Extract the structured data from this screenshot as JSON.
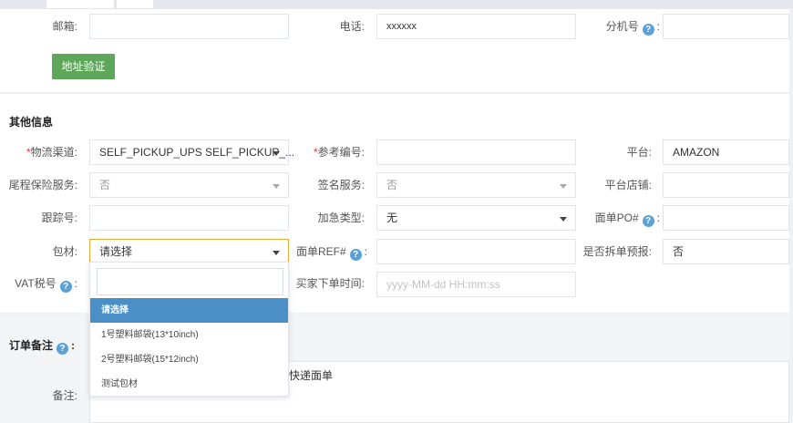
{
  "contact": {
    "email_label": "邮箱:",
    "email_value": "",
    "phone_label": "电话:",
    "phone_value": "xxxxxx",
    "ext_label": "分机号",
    "ext_colon": ":",
    "ext_value": "",
    "verify_button": "地址验证"
  },
  "other_info": {
    "title": "其他信息",
    "channel_label": "物流渠道:",
    "channel_value": "SELF_PICKUP_UPS SELF_PICKUP_...",
    "ref_label": "参考编号:",
    "ref_value": "",
    "platform_label": "平台:",
    "platform_value": "AMAZON",
    "insurance_label": "尾程保险服务:",
    "insurance_value": "否",
    "signature_label": "签名服务:",
    "signature_value": "否",
    "store_label": "平台店铺:",
    "store_value": "",
    "tracking_label": "跟踪号:",
    "tracking_value": "",
    "urgent_label": "加急类型:",
    "urgent_value": "无",
    "po_label": "面单PO#",
    "po_colon": ":",
    "po_value": "",
    "material_label": "包材:",
    "material_value": "请选择",
    "facesheet_ref_label": "面单REF#",
    "facesheet_ref_colon": ":",
    "facesheet_ref_value": "",
    "split_label": "是否拆单预报:",
    "split_value": "否",
    "vat_label": "VAT税号",
    "vat_colon": ":",
    "order_time_label": "买家下单时间:",
    "order_time_placeholder": "yyyy-MM-dd HH:mm:ss"
  },
  "material_dropdown": {
    "search_value": "",
    "options": [
      {
        "label": "请选择",
        "selected": true
      },
      {
        "label": "1号塑料邮袋(13*10inch)",
        "selected": false
      },
      {
        "label": "2号塑料邮袋(15*12inch)",
        "selected": false
      },
      {
        "label": "测试包材",
        "selected": false
      }
    ]
  },
  "order_remarks": {
    "title": "订单备注",
    "title_colon": ":",
    "remark_label": "备注:",
    "remark_text": "快递面单"
  },
  "colors": {
    "accent_green": "#5ea75a",
    "highlight_blue": "#4a90c6",
    "required_red": "#e33",
    "focus_orange": "#e8a93b",
    "help_icon_blue": "#5ba0d8"
  },
  "icons": {
    "help": "question-circle-icon",
    "select": "caret-down-icon"
  }
}
